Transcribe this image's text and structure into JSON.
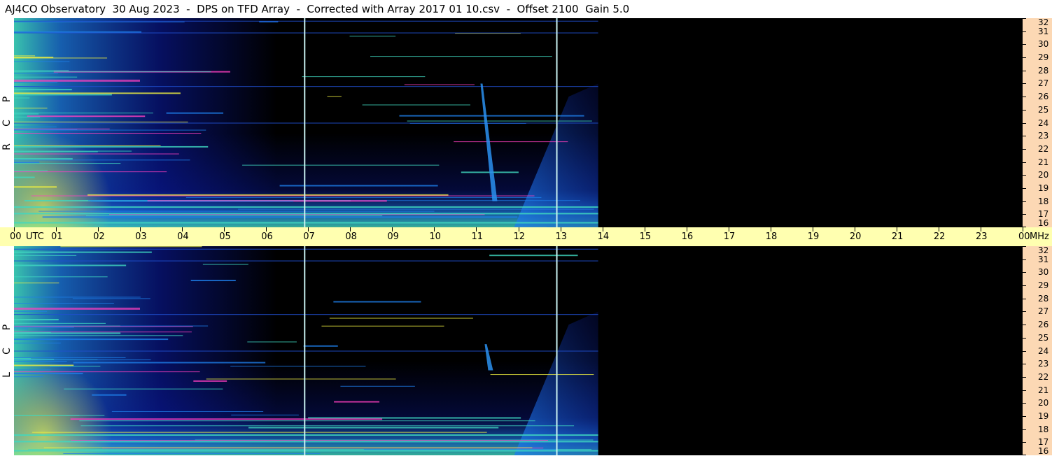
{
  "title": "AJ4CO Observatory  30 Aug 2023  -  DPS on TFD Array  -  Corrected with Array 2017 01 10.csv  -  Offset 2100  Gain 5.0",
  "time_axis": {
    "utc_label": "UTC",
    "unit_label": "MHz",
    "ticks": [
      "00",
      "01",
      "02",
      "03",
      "04",
      "05",
      "06",
      "07",
      "08",
      "09",
      "10",
      "11",
      "12",
      "13",
      "14",
      "15",
      "16",
      "17",
      "18",
      "19",
      "20",
      "21",
      "22",
      "23",
      "00"
    ]
  },
  "panels": [
    {
      "id": "rcp",
      "letters": [
        "R",
        "C",
        "P"
      ]
    },
    {
      "id": "lcp",
      "letters": [
        "L",
        "C",
        "P"
      ]
    }
  ],
  "chart_data": {
    "type": "heatmap",
    "title": "AJ4CO Observatory  30 Aug 2023  -  DPS on TFD Array  -  Corrected with Array 2017 01 10.csv  -  Offset 2100  Gain 5.0",
    "x_unit": "UTC hour",
    "xlim": [
      0,
      24
    ],
    "y_unit": "MHz",
    "ylim": [
      16,
      32
    ],
    "freq_ticks": [
      16,
      17,
      18,
      19,
      20,
      21,
      22,
      23,
      24,
      25,
      26,
      27,
      28,
      29,
      30,
      31,
      32
    ],
    "data_end_hour": 13.9,
    "vertical_markers_hours": [
      6.9,
      12.9
    ],
    "series": [
      {
        "name": "RCP",
        "burst": {
          "start_hour": 11.1,
          "end_hour": 11.45,
          "freq_top": 27,
          "freq_bottom": 18
        }
      },
      {
        "name": "LCP",
        "burst": {
          "start_hour": 11.2,
          "end_hour": 11.35,
          "freq_top": 24.5,
          "freq_bottom": 22.5
        }
      }
    ],
    "colors": {
      "background": "#000000",
      "low": "#0a1aa0",
      "mid": "#1e7ee8",
      "high": "#40d8c0",
      "peak": "#f0f040",
      "rfi": "#ff40c0"
    }
  }
}
